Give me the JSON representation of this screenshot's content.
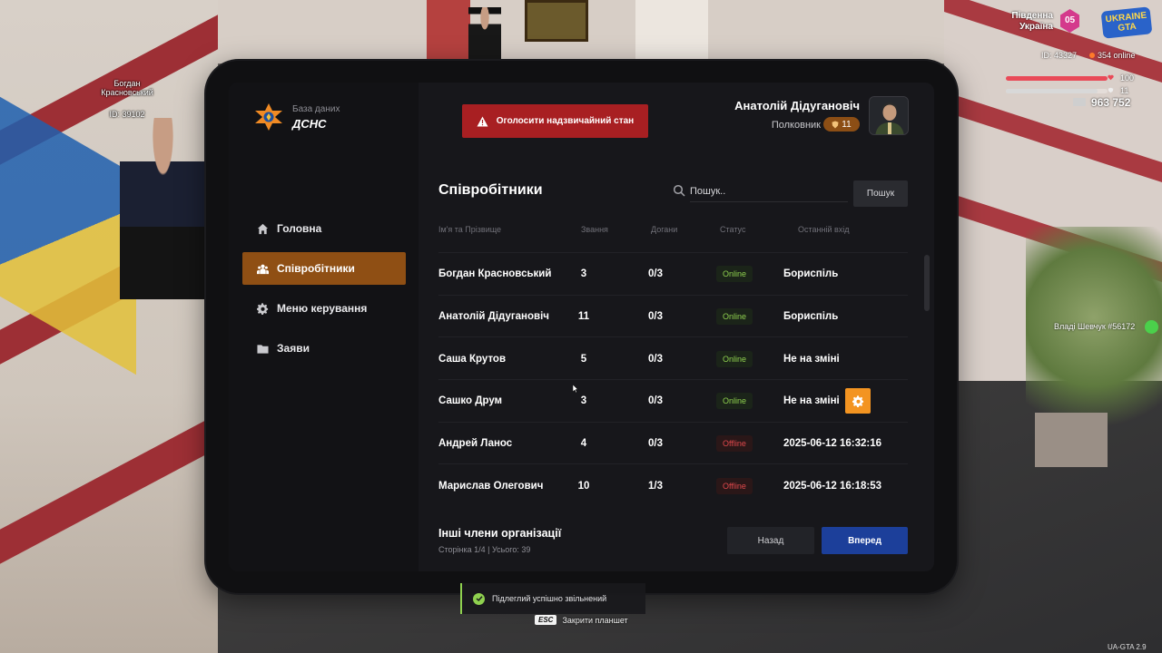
{
  "hud": {
    "nameplate_name": "Богдан Красновський",
    "nameplate_id": "ID: 39102",
    "server_name": "Південна Україна",
    "server_number": "05",
    "server_logo": "UKRAINE GTA",
    "player_id": "ID: 43327",
    "online": "354 online",
    "health": "100",
    "armor": "11",
    "money": "963 752",
    "other_player": "Владі Шевчук #56172",
    "version": "UA-GTA 2.9"
  },
  "tablet": {
    "brand": {
      "subtitle": "База даних",
      "title": "ДСНС",
      "emblem_icon": "dsns-emblem-icon"
    },
    "alert_button": {
      "label": "Оголосити надзвичайний стан",
      "icon": "warning-icon"
    },
    "user": {
      "name": "Анатолій Дідугановіч",
      "rank": "Полковник",
      "rank_level": "11"
    },
    "nav": [
      {
        "label": "Головна",
        "icon": "home-icon",
        "active": false
      },
      {
        "label": "Співробітники",
        "icon": "users-icon",
        "active": true
      },
      {
        "label": "Меню керування",
        "icon": "gear-icon",
        "active": false
      },
      {
        "label": "Заяви",
        "icon": "folder-icon",
        "active": false
      }
    ],
    "page_title": "Співробітники",
    "search": {
      "placeholder": "Пошук..",
      "button_label": "Пошук"
    },
    "columns": {
      "name": "Ім'я та Прізвище",
      "rank": "Звання",
      "warnings": "Догани",
      "status": "Статус",
      "last_login": "Останній вхід"
    },
    "rows": [
      {
        "name": "Богдан Красновський",
        "rank": "3",
        "warnings": "0/3",
        "status": "Online",
        "last_login": "Бориспіль"
      },
      {
        "name": "Анатолій Дідугановіч",
        "rank": "11",
        "warnings": "0/3",
        "status": "Online",
        "last_login": "Бориспіль"
      },
      {
        "name": "Саша Крутов",
        "rank": "5",
        "warnings": "0/3",
        "status": "Online",
        "last_login": "Не на зміні"
      },
      {
        "name": "Сашко Друм",
        "rank": "3",
        "warnings": "0/3",
        "status": "Online",
        "last_login": "Не на зміні"
      },
      {
        "name": "Андрей Ланос",
        "rank": "4",
        "warnings": "0/3",
        "status": "Offline",
        "last_login": "2025-06-12 16:32:16"
      },
      {
        "name": "Марислав Олегович",
        "rank": "10",
        "warnings": "1/3",
        "status": "Offline",
        "last_login": "2025-06-12 16:18:53"
      }
    ],
    "footer": {
      "title": "Інші члени організації",
      "pagination": "Сторінка 1/4 | Усього: 39",
      "back_label": "Назад",
      "next_label": "Вперед"
    }
  },
  "toast": {
    "text": "Підлеглий успішно звільнений"
  },
  "esc_hint": {
    "key": "ESC",
    "text": "Закрити планшет"
  },
  "colors": {
    "accent": "#8f4f14",
    "alert": "#a81f22",
    "next": "#1c3f9a",
    "online": "#8fd14f",
    "offline": "#e0484c",
    "action": "#f39421"
  }
}
